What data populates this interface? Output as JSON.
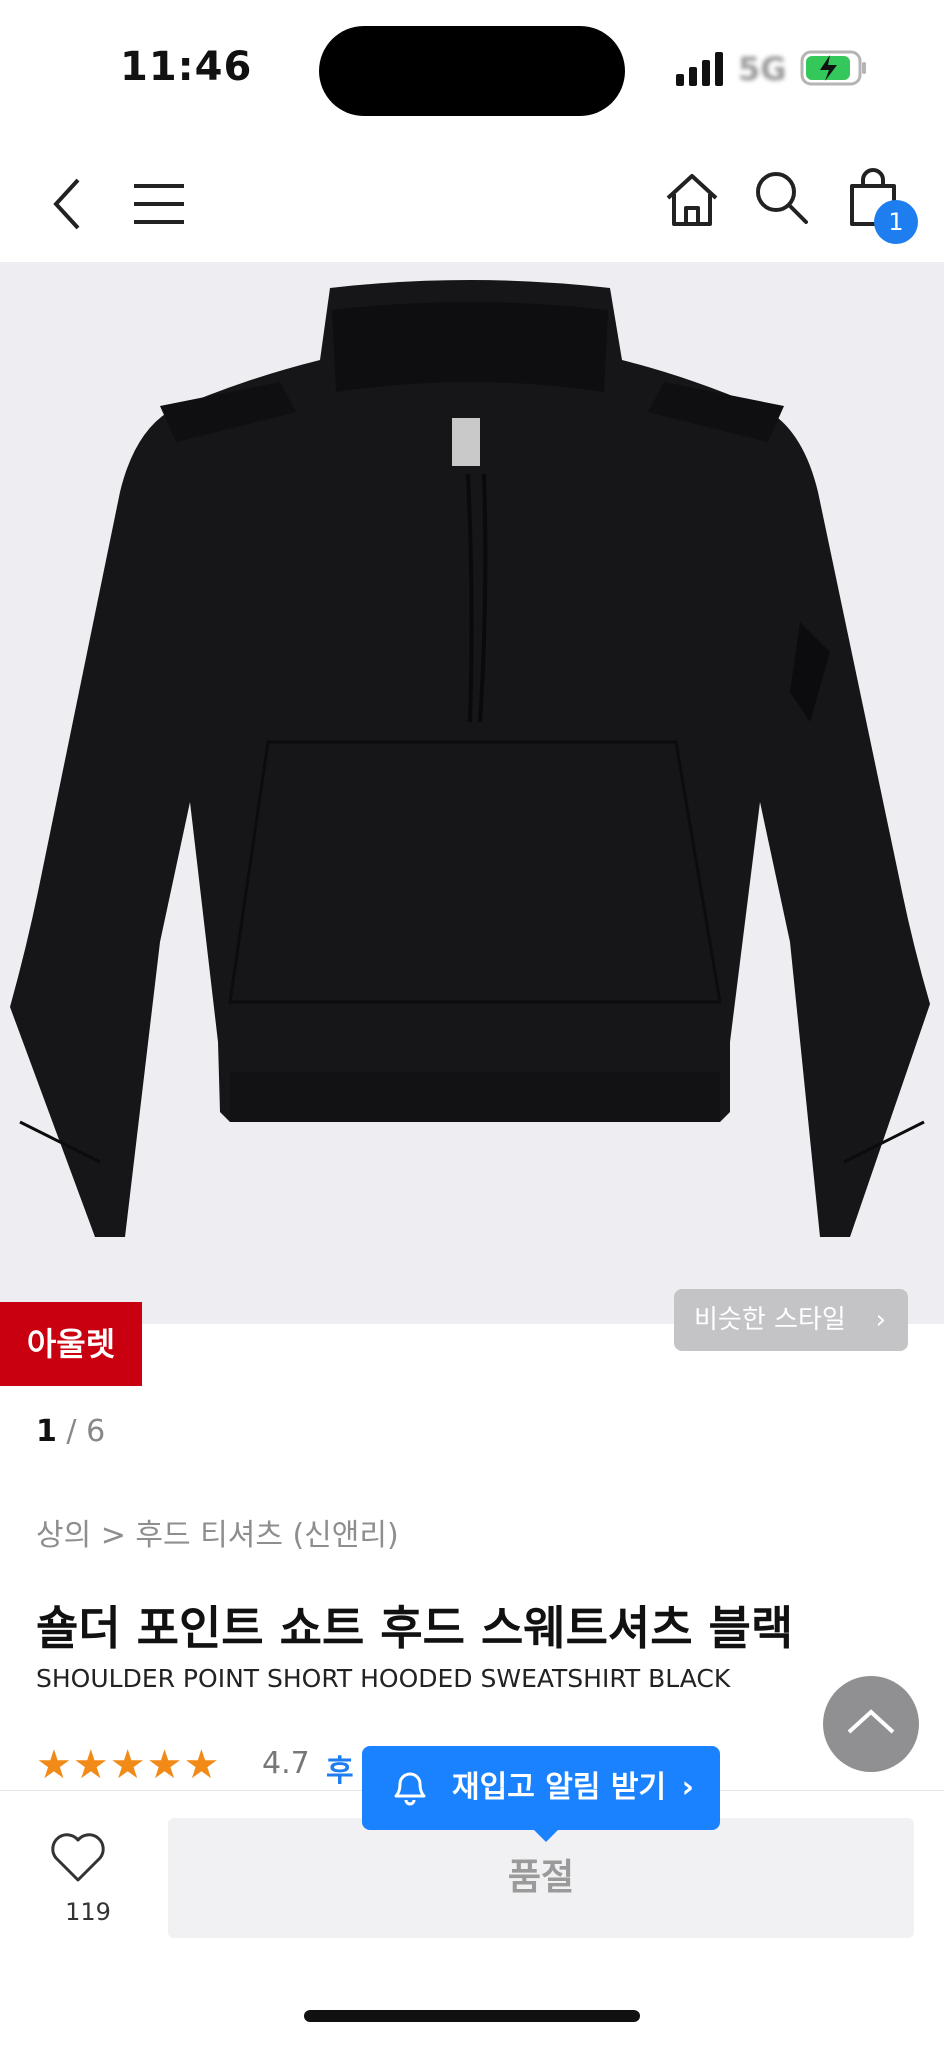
{
  "status_bar": {
    "time": "11:46",
    "network": "5G"
  },
  "nav": {
    "cart_count": "1"
  },
  "hero": {
    "outlet_badge": "아울렛",
    "similar_style_label": "비슷한 스타일",
    "current_image": "1",
    "total_images": "/ 6"
  },
  "product": {
    "breadcrumb": "상의 > 후드 티셔츠 (신앤리)",
    "title_ko": "숄더 포인트 쇼트 후드 스웨트셔츠 블랙",
    "title_en": "SHOULDER POINT SHORT HOODED SWEATSHIRT BLACK",
    "rating": "4.7",
    "rating_stars": 4.7,
    "review_link": "후기"
  },
  "bottom": {
    "like_count": "119",
    "soldout_label": "품절",
    "restock_label": "재입고 알림 받기"
  },
  "colors": {
    "accent": "#1a82ff",
    "outlet": "#c8000f",
    "stars": "#f28a18"
  },
  "icons": [
    "back-icon",
    "menu-icon",
    "home-icon",
    "search-icon",
    "bag-icon",
    "heart-icon",
    "bell-icon",
    "chevron-up-icon"
  ]
}
